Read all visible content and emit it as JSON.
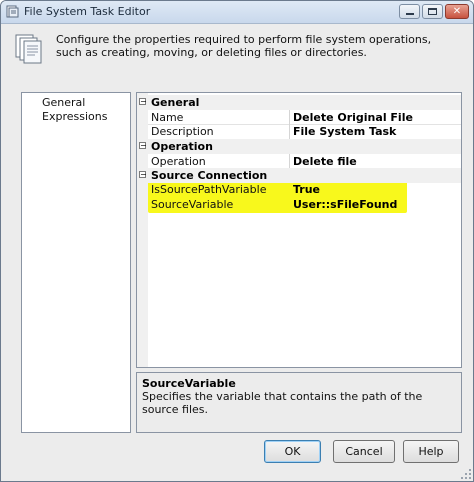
{
  "window": {
    "title": "File System Task Editor"
  },
  "header": {
    "description": "Configure the properties required to perform file system operations, such as creating, moving, or deleting files or directories."
  },
  "nav": {
    "items": [
      {
        "label": "General"
      },
      {
        "label": "Expressions"
      }
    ]
  },
  "grid": {
    "categories": [
      {
        "label": "General",
        "rows": [
          {
            "name": "Name",
            "value": "Delete Original File"
          },
          {
            "name": "Description",
            "value": "File System Task"
          }
        ]
      },
      {
        "label": "Operation",
        "rows": [
          {
            "name": "Operation",
            "value": "Delete file"
          }
        ]
      },
      {
        "label": "Source Connection",
        "rows": [
          {
            "name": "IsSourcePathVariable",
            "value": "True"
          },
          {
            "name": "SourceVariable",
            "value": "User::sFileFound"
          }
        ]
      }
    ],
    "highlight_color": "#f8f81c"
  },
  "description_panel": {
    "title": "SourceVariable",
    "text": "Specifies the variable that contains the path of the source files."
  },
  "buttons": {
    "ok": "OK",
    "cancel": "Cancel",
    "help": "Help"
  },
  "icons": {
    "window": "task-icon",
    "header": "documents-icon",
    "expander": "collapse-icon",
    "grip": "resize-grip-icon"
  }
}
